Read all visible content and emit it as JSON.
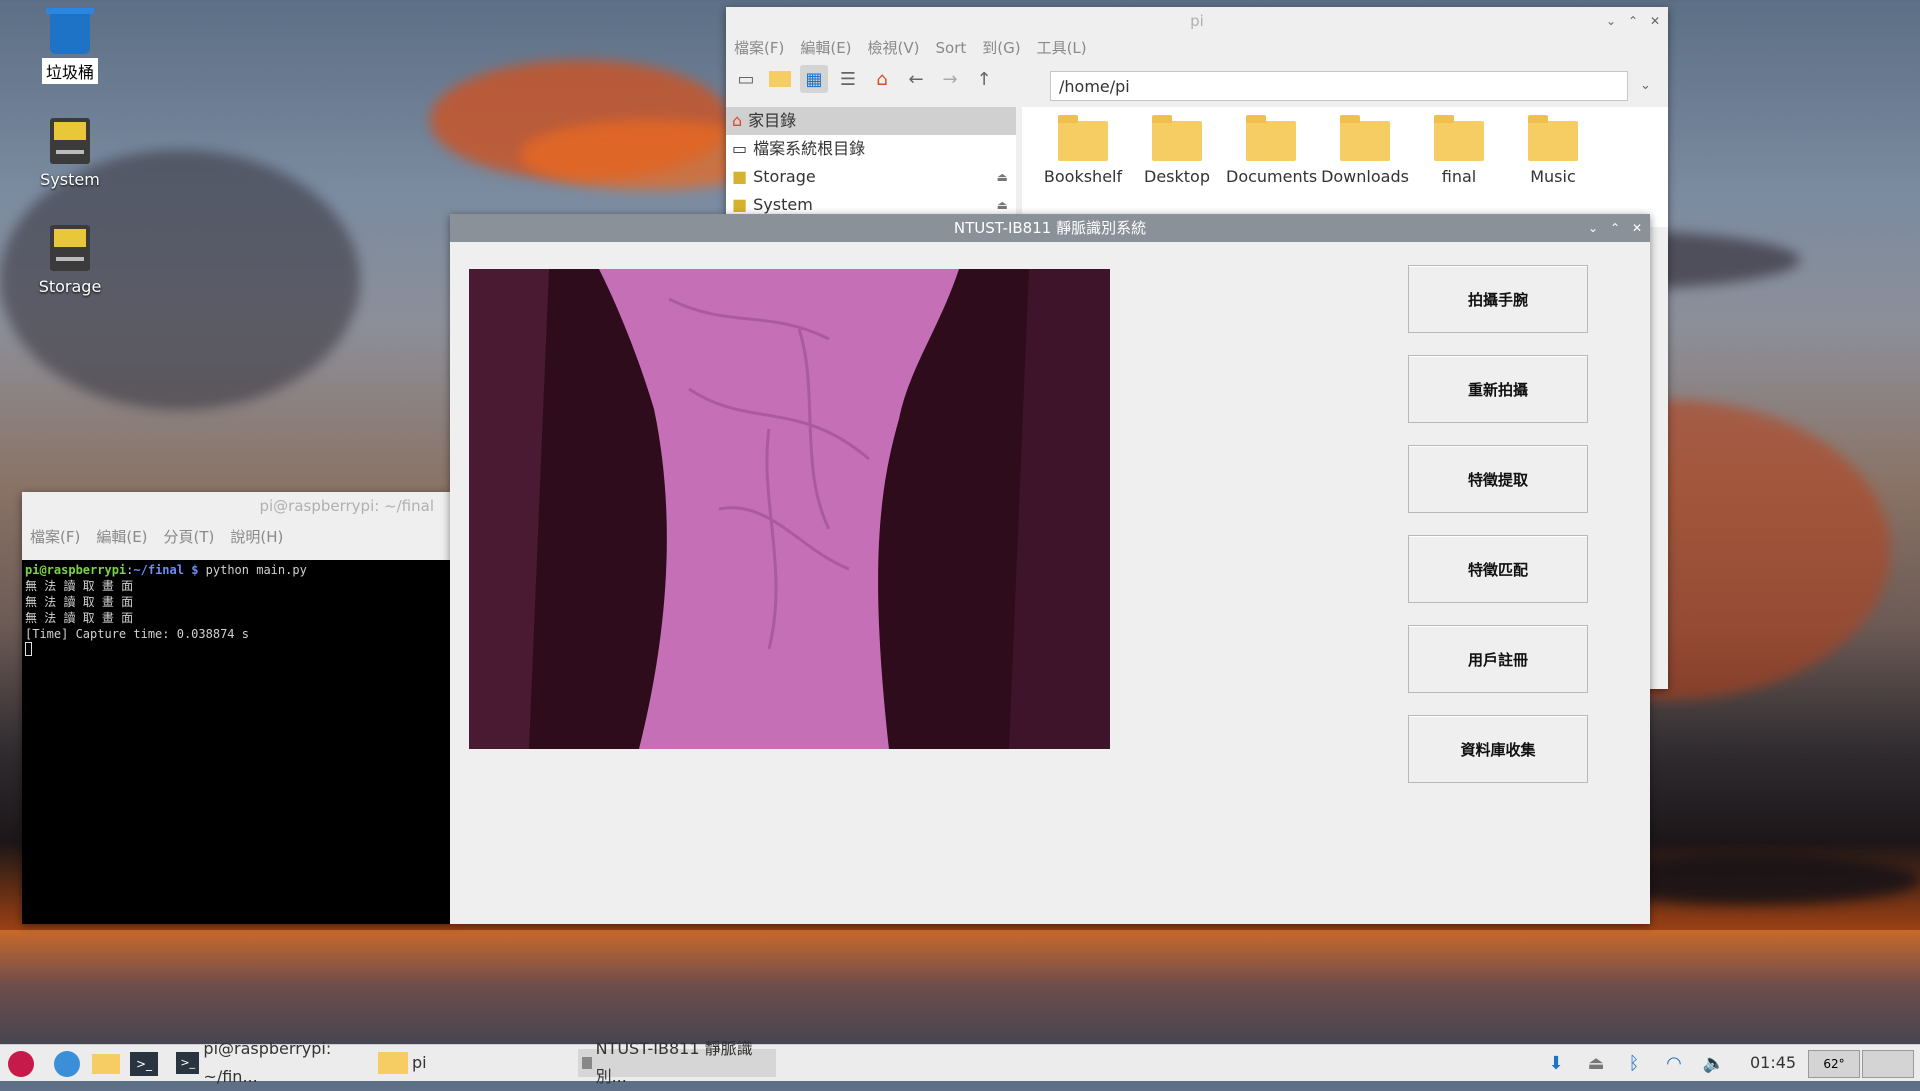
{
  "desktop": {
    "icons": [
      {
        "label": "垃圾桶"
      },
      {
        "label": "System"
      },
      {
        "label": "Storage"
      }
    ]
  },
  "file_manager": {
    "title": "pi",
    "menu": [
      "檔案(F)",
      "編輯(E)",
      "檢視(V)",
      "Sort",
      "到(G)",
      "工具(L)"
    ],
    "path": "/home/pi",
    "sidebar": [
      {
        "label": "家目錄"
      },
      {
        "label": "檔案系統根目錄"
      },
      {
        "label": "Storage"
      },
      {
        "label": "System"
      }
    ],
    "folders": [
      "Bookshelf",
      "Desktop",
      "Documents",
      "Downloads",
      "final",
      "Music"
    ]
  },
  "terminal": {
    "title": "pi@raspberrypi: ~/final",
    "menu": [
      "檔案(F)",
      "編輯(E)",
      "分頁(T)",
      "說明(H)"
    ],
    "prompt_user": "pi@raspberrypi",
    "prompt_path": "~/final $",
    "command": "python main.py",
    "lines": [
      "無 法 讀 取 畫 面",
      "無 法 讀 取 畫 面",
      "無 法 讀 取 畫 面",
      "[Time] Capture time: 0.038874 s"
    ]
  },
  "app": {
    "title": "NTUST-IB811 靜脈識別系統",
    "buttons": [
      "拍攝手腕",
      "重新拍攝",
      "特徵提取",
      "特徵匹配",
      "用戶註冊",
      "資料庫收集"
    ]
  },
  "taskbar": {
    "tasks": [
      "pi@raspberrypi: ~/fin...",
      "pi",
      "NTUST-IB811 靜脈識別..."
    ],
    "clock": "01:45",
    "temp": "62°"
  }
}
